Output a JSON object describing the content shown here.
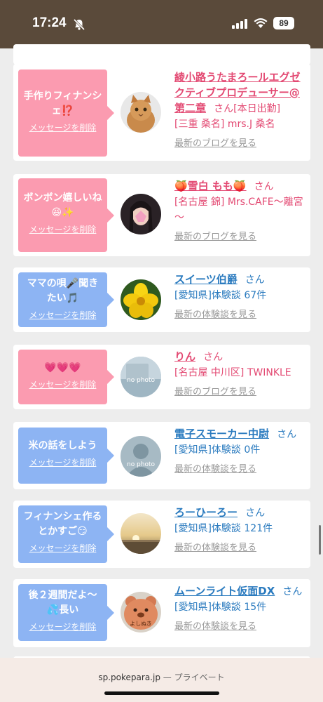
{
  "status_bar": {
    "time": "17:24",
    "battery": "89"
  },
  "browser": {
    "url": "sp.pokepara.jp",
    "separator": "—",
    "mode": "プライベート"
  },
  "cards": [
    {
      "message": "手作りフィナンシェ⁉️",
      "delete_label": "メッセージを削除",
      "bubble_color": "pink",
      "name": "綾小路うたまろールエグゼクティブプロデューサー@第二章",
      "san": "さん",
      "status": "[本日出勤]",
      "detail": "[三重 桑名] mrs.J 桑名",
      "link": "最新のブログを見る",
      "avatar": "cat-photo"
    },
    {
      "message": "ボンボン嬉しいね😆✨",
      "delete_label": "メッセージを削除",
      "bubble_color": "pink",
      "name": "🍑雪白 もも🍑",
      "san": "さん",
      "detail": "[名古屋 錦] Mrs.CAFE～離宮～",
      "link": "最新のブログを見る",
      "avatar": "woman-photo"
    },
    {
      "message": "ママの唄🎤聞きたい🎵",
      "delete_label": "メッセージを削除",
      "bubble_color": "blue",
      "name": "スイーツ伯爵",
      "san": "さん",
      "detail": "[愛知県]体験談 67件",
      "link": "最新の体験談を見る",
      "avatar": "flower-photo"
    },
    {
      "message": "💗💗💗",
      "delete_label": "メッセージを削除",
      "bubble_color": "pink",
      "name": "りん",
      "san": "さん",
      "detail": "[名古屋 中川区] TWINKLE",
      "link": "最新のブログを見る",
      "avatar": "no-photo",
      "avatar_text": "no photo"
    },
    {
      "message": "米の話をしよう",
      "delete_label": "メッセージを削除",
      "bubble_color": "blue",
      "name": "電子スモーカー中尉",
      "san": "さん",
      "detail": "[愛知県]体験談 0件",
      "link": "最新の体験談を見る",
      "avatar": "no-photo-silhouette",
      "avatar_text": "no photo"
    },
    {
      "message": "フィナンシェ作るとかすご😏",
      "delete_label": "メッセージを削除",
      "bubble_color": "blue",
      "name": "ろーひーろー",
      "san": "さん",
      "detail": "[愛知県]体験談 121件",
      "link": "最新の体験談を見る",
      "avatar": "sunset-photo"
    },
    {
      "message": "後２週間だよ〜💦長い",
      "delete_label": "メッセージを削除",
      "bubble_color": "blue",
      "name": "ムーンライト仮面DX",
      "san": "さん",
      "detail": "[愛知県]体験談 15件",
      "link": "最新の体験談を見る",
      "avatar": "bear-photo",
      "avatar_text": "よしぬき"
    }
  ]
}
